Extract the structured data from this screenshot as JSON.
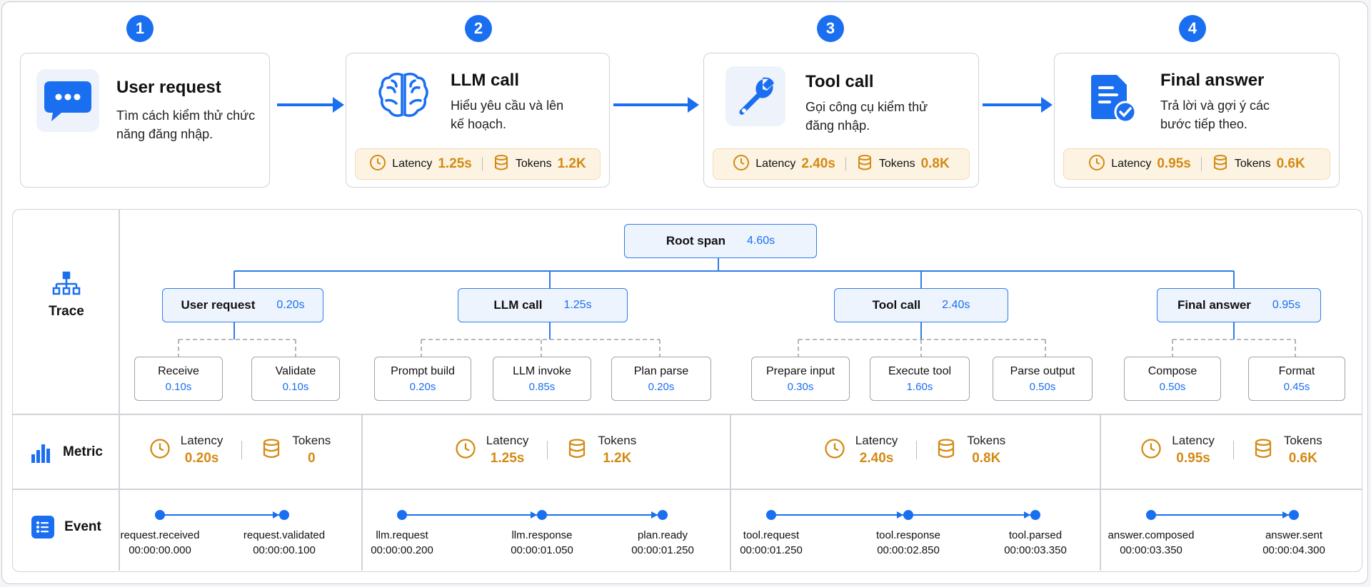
{
  "steps": [
    {
      "num": "1",
      "title": "User request",
      "desc": "Tìm cách kiểm thử chức năng đăng nhập.",
      "icon": "chat-bubble-icon"
    },
    {
      "num": "2",
      "title": "LLM call",
      "desc": "Hiểu yêu cầu và lên kế hoạch.",
      "icon": "brain-icon",
      "latency_label": "Latency",
      "latency": "1.25s",
      "tokens_label": "Tokens",
      "tokens": "1.2K"
    },
    {
      "num": "3",
      "title": "Tool call",
      "desc": "Gọi công cụ kiểm thử đăng nhập.",
      "icon": "wrench-icon",
      "latency_label": "Latency",
      "latency": "2.40s",
      "tokens_label": "Tokens",
      "tokens": "0.8K"
    },
    {
      "num": "4",
      "title": "Final answer",
      "desc": "Trả lời và gợi ý các bước tiếp theo.",
      "icon": "document-check-icon",
      "latency_label": "Latency",
      "latency": "0.95s",
      "tokens_label": "Tokens",
      "tokens": "0.6K"
    }
  ],
  "rows": {
    "trace": "Trace",
    "metric": "Metric",
    "event": "Event"
  },
  "trace": {
    "root": {
      "name": "Root span",
      "dur": "4.60s"
    },
    "spans": [
      {
        "name": "User request",
        "dur": "0.20s",
        "children": [
          {
            "name": "Receive",
            "dur": "0.10s"
          },
          {
            "name": "Validate",
            "dur": "0.10s"
          }
        ]
      },
      {
        "name": "LLM call",
        "dur": "1.25s",
        "children": [
          {
            "name": "Prompt build",
            "dur": "0.20s"
          },
          {
            "name": "LLM invoke",
            "dur": "0.85s"
          },
          {
            "name": "Plan parse",
            "dur": "0.20s"
          }
        ]
      },
      {
        "name": "Tool call",
        "dur": "2.40s",
        "children": [
          {
            "name": "Prepare input",
            "dur": "0.30s"
          },
          {
            "name": "Execute tool",
            "dur": "1.60s"
          },
          {
            "name": "Parse output",
            "dur": "0.50s"
          }
        ]
      },
      {
        "name": "Final answer",
        "dur": "0.95s",
        "children": [
          {
            "name": "Compose",
            "dur": "0.50s"
          },
          {
            "name": "Format",
            "dur": "0.45s"
          }
        ]
      }
    ]
  },
  "metrics": [
    {
      "latency_label": "Latency",
      "latency": "0.20s",
      "tokens_label": "Tokens",
      "tokens": "0"
    },
    {
      "latency_label": "Latency",
      "latency": "1.25s",
      "tokens_label": "Tokens",
      "tokens": "1.2K"
    },
    {
      "latency_label": "Latency",
      "latency": "2.40s",
      "tokens_label": "Tokens",
      "tokens": "0.8K"
    },
    {
      "latency_label": "Latency",
      "latency": "0.95s",
      "tokens_label": "Tokens",
      "tokens": "0.6K"
    }
  ],
  "events": [
    [
      {
        "name": "request.received",
        "time": "00:00:00.000"
      },
      {
        "name": "request.validated",
        "time": "00:00:00.100"
      }
    ],
    [
      {
        "name": "llm.request",
        "time": "00:00:00.200"
      },
      {
        "name": "llm.response",
        "time": "00:00:01.050"
      },
      {
        "name": "plan.ready",
        "time": "00:00:01.250"
      }
    ],
    [
      {
        "name": "tool.request",
        "time": "00:00:01.250"
      },
      {
        "name": "tool.response",
        "time": "00:00:02.850"
      },
      {
        "name": "tool.parsed",
        "time": "00:00:03.350"
      }
    ],
    [
      {
        "name": "answer.composed",
        "time": "00:00:03.350"
      },
      {
        "name": "answer.sent",
        "time": "00:00:04.300"
      }
    ]
  ],
  "colors": {
    "accent": "#1a6ff0",
    "metric": "#d38a12",
    "metric_bg": "#fdf3e3"
  }
}
